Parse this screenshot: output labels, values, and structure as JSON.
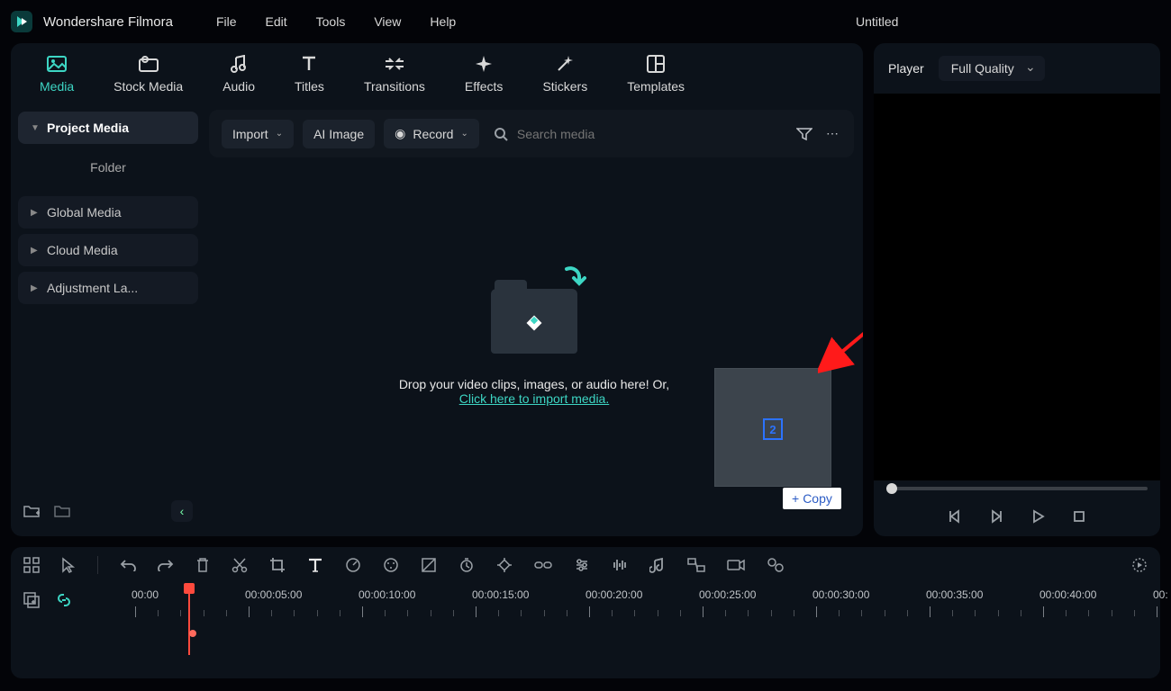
{
  "app_name": "Wondershare Filmora",
  "document_title": "Untitled",
  "menu": [
    "File",
    "Edit",
    "Tools",
    "View",
    "Help"
  ],
  "tabs": [
    {
      "label": "Media",
      "active": true
    },
    {
      "label": "Stock Media"
    },
    {
      "label": "Audio"
    },
    {
      "label": "Titles"
    },
    {
      "label": "Transitions"
    },
    {
      "label": "Effects"
    },
    {
      "label": "Stickers"
    },
    {
      "label": "Templates"
    }
  ],
  "sidebar": {
    "project": "Project Media",
    "folder": "Folder",
    "items": [
      "Global Media",
      "Cloud Media",
      "Adjustment La..."
    ]
  },
  "toolbar": {
    "import": "Import",
    "ai_image": "AI Image",
    "record": "Record",
    "search_placeholder": "Search media"
  },
  "dropzone": {
    "line1": "Drop your video clips, images, or audio here! Or,",
    "link": "Click here to import media."
  },
  "overlay": {
    "badge": "2",
    "copy": "Copy"
  },
  "player": {
    "label": "Player",
    "quality": "Full Quality"
  },
  "timeline": {
    "timestamps": [
      "00:00",
      "00:00:05:00",
      "00:00:10:00",
      "00:00:15:00",
      "00:00:20:00",
      "00:00:25:00",
      "00:00:30:00",
      "00:00:35:00",
      "00:00:40:00",
      "00:"
    ]
  }
}
